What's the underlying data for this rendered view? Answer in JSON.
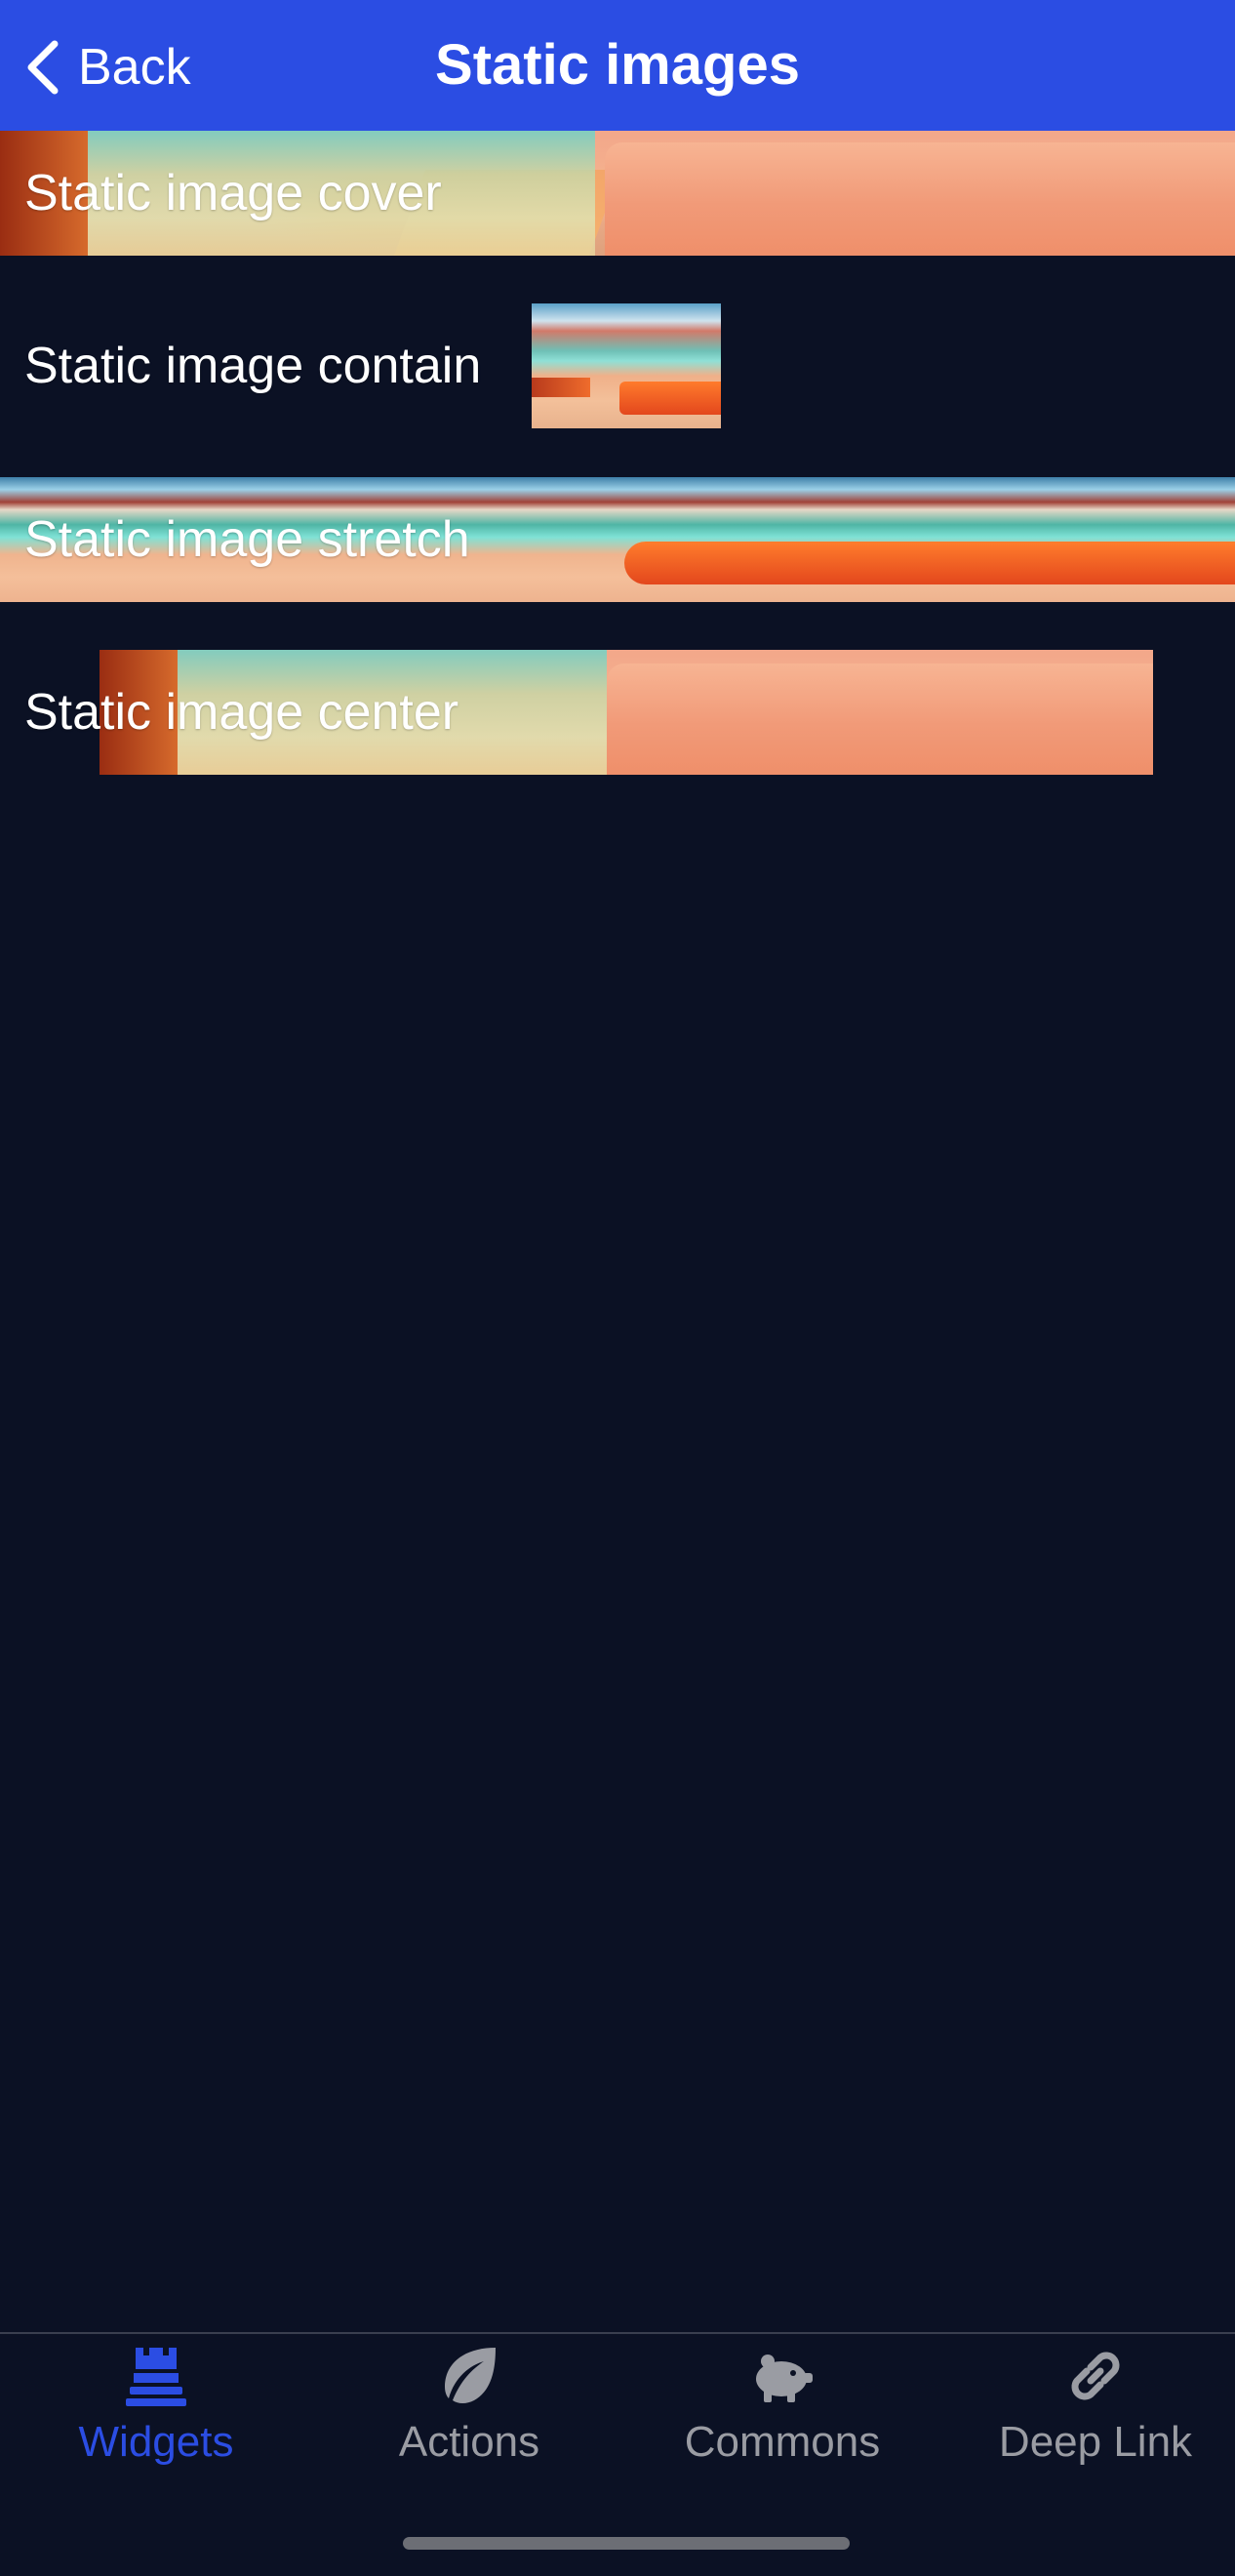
{
  "header": {
    "back_label": "Back",
    "title": "Static images",
    "background": "#2b4de3"
  },
  "rows": [
    {
      "label": "Static image cover"
    },
    {
      "label": "Static image contain"
    },
    {
      "label": "Static image stretch"
    },
    {
      "label": "Static image center"
    }
  ],
  "tabs": [
    {
      "label": "Widgets",
      "icon": "tower-icon",
      "active": true
    },
    {
      "label": "Actions",
      "icon": "leaf-icon",
      "active": false
    },
    {
      "label": "Commons",
      "icon": "piggy-bank-icon",
      "active": false
    },
    {
      "label": "Deep Link",
      "icon": "link-icon",
      "active": false
    }
  ],
  "colors": {
    "background": "#0b1124",
    "accent": "#2b4de3",
    "tab_inactive": "#9a9ca3"
  }
}
